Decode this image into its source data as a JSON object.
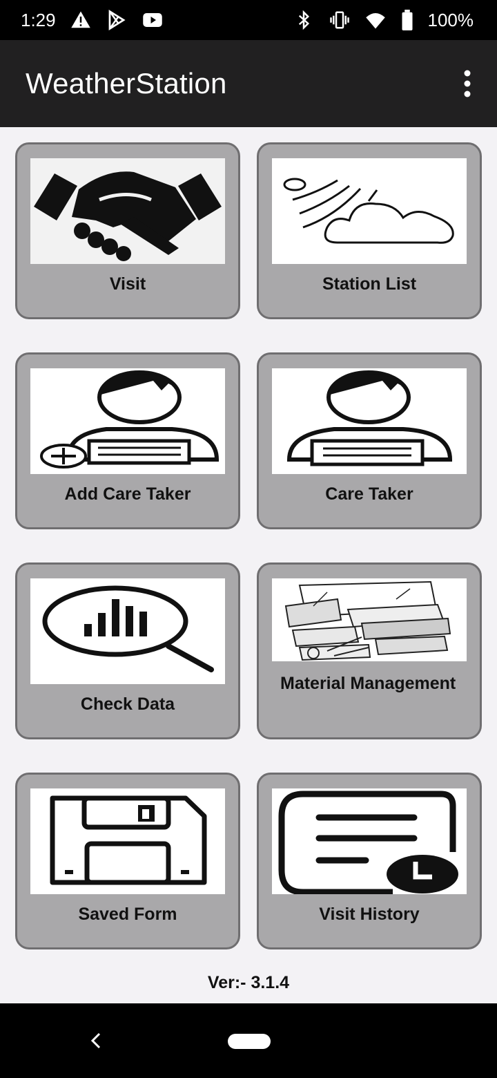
{
  "status_bar": {
    "time": "1:29",
    "battery_percent": "100%",
    "icons_left": [
      "warning-icon",
      "play-store-icon",
      "youtube-icon"
    ],
    "icons_right": [
      "bluetooth-icon",
      "vibrate-icon",
      "wifi-icon",
      "battery-icon"
    ]
  },
  "app_bar": {
    "title": "WeatherStation",
    "overflow_icon": "more-vert-icon"
  },
  "tiles": [
    {
      "label": "Visit",
      "icon": "handshake-icon"
    },
    {
      "label": "Station List",
      "icon": "weather-cloud-icon"
    },
    {
      "label": "Add Care Taker",
      "icon": "add-person-icon"
    },
    {
      "label": "Care Taker",
      "icon": "person-icon"
    },
    {
      "label": "Check Data",
      "icon": "magnifier-chart-icon"
    },
    {
      "label": "Material Management",
      "icon": "materials-pile-icon"
    },
    {
      "label": "Saved Form",
      "icon": "floppy-disk-icon"
    },
    {
      "label": "Visit History",
      "icon": "history-document-icon"
    }
  ],
  "version": "Ver:- 3.1.4",
  "colors": {
    "status_bar_bg": "#000000",
    "app_bar_bg": "#212021",
    "page_bg": "#f3f2f5",
    "tile_bg": "#a9a8aa",
    "tile_border": "#6f6e70"
  }
}
